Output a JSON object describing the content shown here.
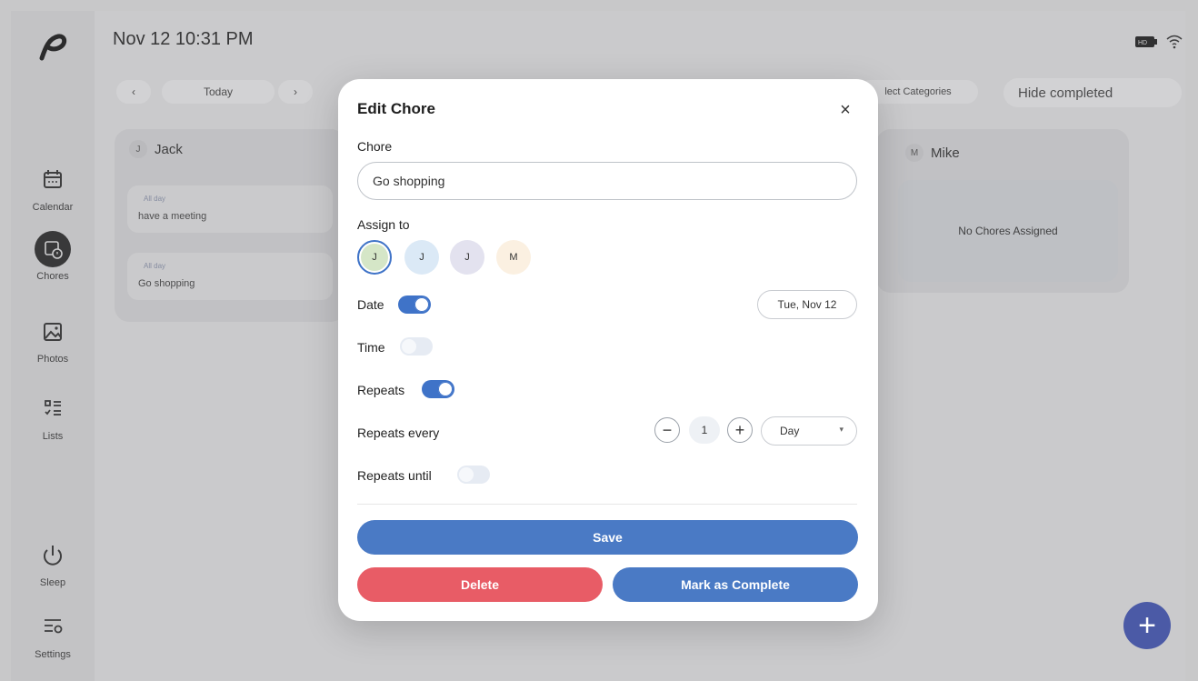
{
  "status_bar": {
    "datetime": "Nov 12 10:31 PM",
    "icons": [
      "battery-icon",
      "wifi-icon"
    ]
  },
  "sidebar": {
    "items": [
      {
        "label": "Calendar",
        "icon": "calendar-icon"
      },
      {
        "label": "Chores",
        "icon": "chores-icon",
        "active": true
      },
      {
        "label": "Photos",
        "icon": "photos-icon"
      },
      {
        "label": "Lists",
        "icon": "lists-icon"
      },
      {
        "label": "Sleep",
        "icon": "power-icon"
      },
      {
        "label": "Settings",
        "icon": "settings-icon"
      }
    ]
  },
  "toolbar": {
    "prev": "‹",
    "today": "Today",
    "next": "›",
    "select_categories": "lect Categories",
    "hide_completed": "Hide completed"
  },
  "columns": {
    "jack": {
      "initial": "J",
      "name": "Jack",
      "chores": [
        {
          "tag": "All day",
          "name": "have a meeting"
        },
        {
          "tag": "All day",
          "name": "Go shopping"
        }
      ]
    },
    "mike": {
      "initial": "M",
      "name": "Mike",
      "empty": "No Chores Assigned"
    }
  },
  "fab": {
    "label": "+"
  },
  "modal": {
    "title": "Edit Chore",
    "close": "×",
    "chore_label": "Chore",
    "chore_value": "Go shopping",
    "assign_label": "Assign to",
    "assignees": [
      {
        "initial": "J",
        "color": "#d5e6c7",
        "selected": true
      },
      {
        "initial": "J",
        "color": "#dbe9f6",
        "selected": false
      },
      {
        "initial": "J",
        "color": "#e3e2ef",
        "selected": false
      },
      {
        "initial": "M",
        "color": "#fbf0e1",
        "selected": false
      }
    ],
    "date_label": "Date",
    "date_enabled": true,
    "date_value": "Tue, Nov 12",
    "time_label": "Time",
    "time_enabled": false,
    "repeats_label": "Repeats",
    "repeats_enabled": true,
    "repeats_every_label": "Repeats every",
    "stepper_minus": "−",
    "repeat_interval": "1",
    "stepper_plus": "+",
    "repeat_unit": "Day",
    "repeats_until_label": "Repeats until",
    "repeats_until_enabled": false,
    "save_label": "Save",
    "delete_label": "Delete",
    "complete_label": "Mark as Complete"
  },
  "colors": {
    "accent": "#4a7ac5",
    "danger": "#e85c66",
    "toggle_on": "#3f73c8",
    "fab": "#4b5aa6"
  }
}
